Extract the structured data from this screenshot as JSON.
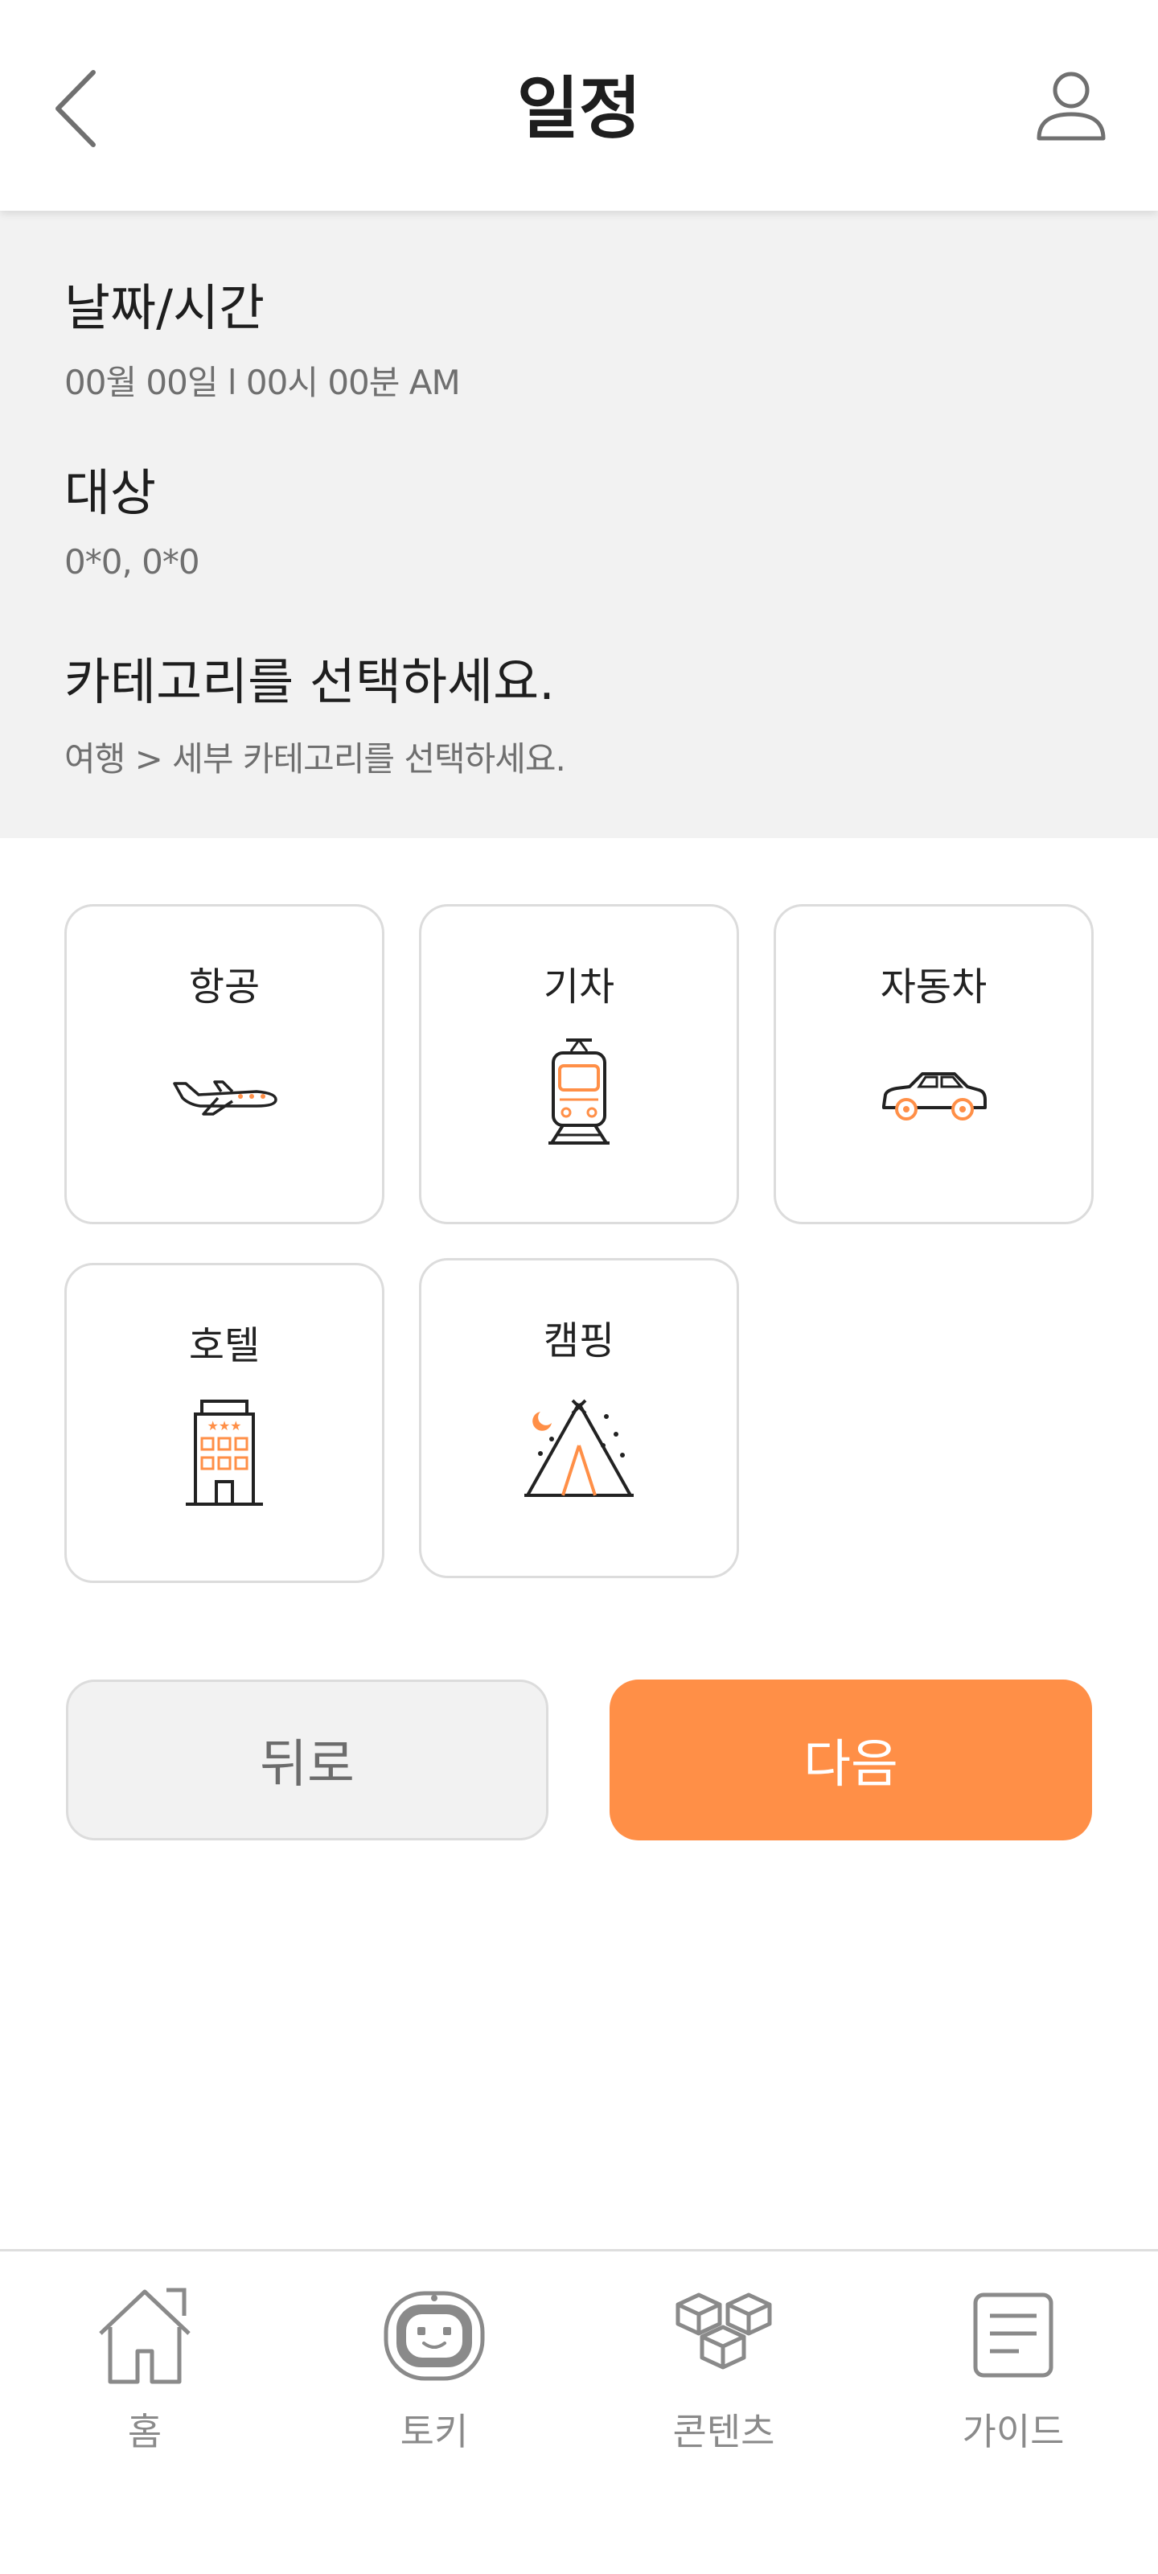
{
  "header": {
    "title": "일정",
    "back_icon": "chevron-left-icon",
    "profile_icon": "user-icon"
  },
  "info": {
    "datetime_label": "날짜/시간",
    "datetime_value": "00월 00일  l  00시 00분  AM",
    "target_label": "대상",
    "target_value": "0*0, 0*0",
    "category_label": "카테고리를 선택하세요.",
    "category_hint": "여행 > 세부 카테고리를 선택하세요."
  },
  "categories": [
    {
      "label": "항공",
      "icon": "airplane-icon"
    },
    {
      "label": "기차",
      "icon": "train-icon"
    },
    {
      "label": "자동차",
      "icon": "car-icon"
    },
    {
      "label": "호텔",
      "icon": "hotel-icon"
    },
    {
      "label": "캠핑",
      "icon": "camping-tent-icon"
    }
  ],
  "buttons": {
    "back_label": "뒤로",
    "next_label": "다음"
  },
  "bottom_nav": [
    {
      "label": "홈",
      "icon": "home-icon"
    },
    {
      "label": "토키",
      "icon": "robot-icon"
    },
    {
      "label": "콘텐츠",
      "icon": "cubes-icon"
    },
    {
      "label": "가이드",
      "icon": "document-icon"
    }
  ],
  "colors": {
    "accent": "#ff8f47",
    "panel_bg": "#f2f2f2",
    "border": "#dcdcdc",
    "nav_gray": "#8a8a8a"
  }
}
